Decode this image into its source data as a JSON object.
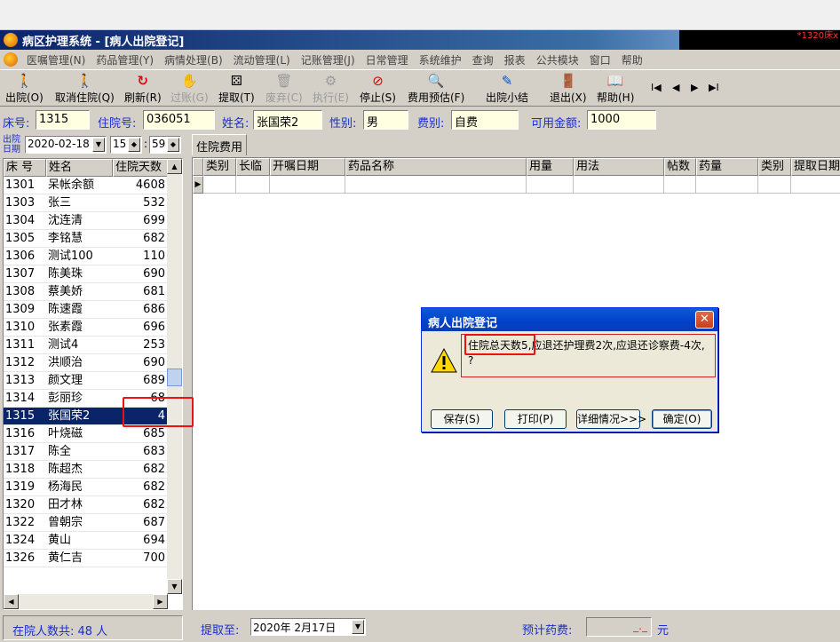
{
  "window": {
    "title": "病区护理系统 - [病人出院登记]",
    "corner_text": "*1320床x"
  },
  "menu": [
    "医嘱管理(N)",
    "药品管理(Y)",
    "病情处理(B)",
    "流动管理(L)",
    "记账管理(J)",
    "日常管理",
    "系统维护",
    "查询",
    "报表",
    "公共模块",
    "窗口",
    "帮助"
  ],
  "toolbar": {
    "discharge": "出院(O)",
    "cancel_admit": "取消住院(Q)",
    "refresh": "刷新(R)",
    "post": "过账(G)",
    "fetch": "提取(T)",
    "discard": "废弃(C)",
    "execute": "执行(E)",
    "stop": "停止(S)",
    "estimate": "费用预估(F)",
    "summary": "出院小结",
    "exit": "退出(X)",
    "help": "帮助(H)",
    "nav_first": "I◀",
    "nav_prev": "◀",
    "nav_next": "▶",
    "nav_last": "▶I"
  },
  "patient": {
    "bed_label": "床号:",
    "bed": "1315",
    "admit_label": "住院号:",
    "admit_no": "036051",
    "name_label": "姓名:",
    "name": "张国荣2",
    "sex_label": "性别:",
    "sex": "男",
    "fee_label": "费别:",
    "fee_type": "自费",
    "avail_label": "可用金额:",
    "avail": "1000"
  },
  "discharge_date": {
    "label_top": "出院",
    "label_bottom": "日期",
    "date": "2020-02-18",
    "hour": "15",
    "minute": "59"
  },
  "tab": "住院费用",
  "bed_list": {
    "headers": [
      "床 号",
      "姓名",
      "住院天数"
    ],
    "rows": [
      [
        "1301",
        "呆帐余额",
        "4608"
      ],
      [
        "1303",
        "张三",
        "532"
      ],
      [
        "1304",
        "沈连清",
        "699"
      ],
      [
        "1305",
        "李铭慧",
        "682"
      ],
      [
        "1306",
        "测试100",
        "110"
      ],
      [
        "1307",
        "陈美珠",
        "690"
      ],
      [
        "1308",
        "蔡美娇",
        "681"
      ],
      [
        "1309",
        "陈速霞",
        "686"
      ],
      [
        "1310",
        "张素霞",
        "696"
      ],
      [
        "1311",
        "测试4",
        "253"
      ],
      [
        "1312",
        "洪顺治",
        "690"
      ],
      [
        "1313",
        "颜文理",
        "689"
      ],
      [
        "1314",
        "彭丽珍",
        "68"
      ],
      [
        "1315",
        "张国荣2",
        "4"
      ],
      [
        "1316",
        "叶烧磁",
        "685"
      ],
      [
        "1317",
        "陈全",
        "683"
      ],
      [
        "1318",
        "陈超杰",
        "682"
      ],
      [
        "1319",
        "杨海民",
        "682"
      ],
      [
        "1320",
        "田才林",
        "682"
      ],
      [
        "1322",
        "曾朝宗",
        "687"
      ],
      [
        "1324",
        "黄山",
        "694"
      ],
      [
        "1326",
        "黄仁吉",
        "700"
      ]
    ],
    "selected_bed": "1315"
  },
  "fee_grid": {
    "headers": [
      "类别",
      "长临",
      "开嘱日期",
      "药品名称",
      "用量",
      "用法",
      "帖数",
      "药量",
      "类别",
      "提取日期"
    ]
  },
  "status": {
    "inpatients": "在院人数共: 48 人",
    "fetch_label": "提取至:",
    "fetch_date": "2020年  2月17日",
    "est_label": "预计药费:",
    "est_value": "_._",
    "currency": "元"
  },
  "dialog": {
    "title": "病人出院登记",
    "msg_highlight": "住院总天数5",
    "msg_rest": ",应退还护理费2次,应退还诊察费-4次,",
    "msg_line2": "?",
    "buttons": {
      "save": "保存(S)",
      "print": "打印(P)",
      "detail": "详细情况>>>",
      "ok": "确定(O)"
    }
  }
}
